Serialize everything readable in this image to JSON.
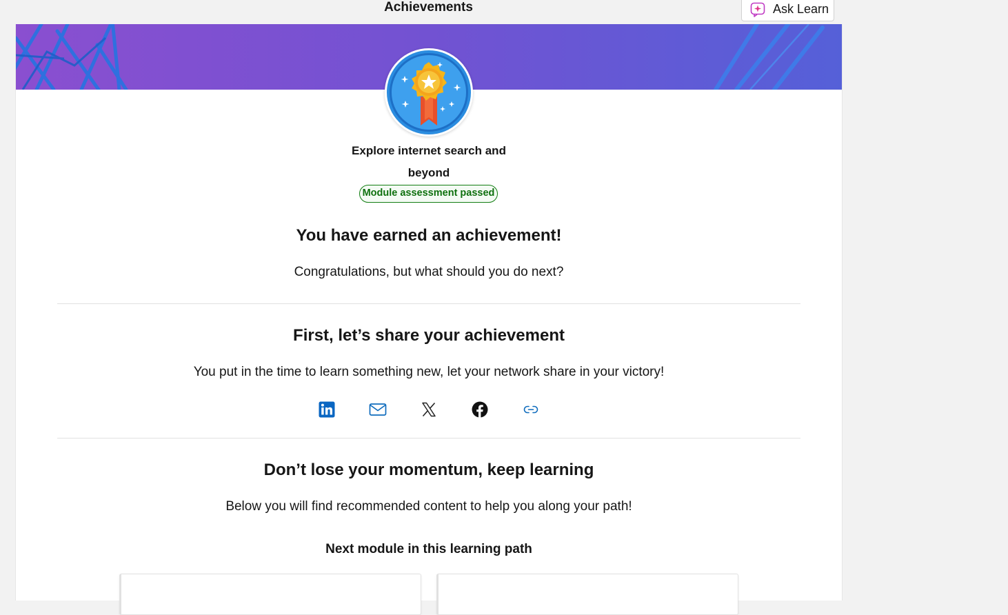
{
  "header": {
    "title": "Achievements",
    "ask_learn_label": "Ask Learn"
  },
  "achievement": {
    "module_title": "Explore internet search and beyond",
    "status": "Module assessment passed",
    "badge_icon": "medal-icon"
  },
  "earned": {
    "heading": "You have earned an achievement!",
    "subtext": "Congratulations, but what should you do next?"
  },
  "share": {
    "heading": "First, let’s share your achievement",
    "subtext": "You put in the time to learn something new, let your network share in your victory!",
    "buttons": [
      "linkedin-icon",
      "email-icon",
      "x-icon",
      "facebook-icon",
      "link-icon"
    ]
  },
  "keep_learning": {
    "heading": "Don’t lose your momentum, keep learning",
    "subtext": "Below you will find recommended content to help you along your path!",
    "next_module_heading": "Next module in this learning path"
  },
  "colors": {
    "banner_start": "#8a4fd0",
    "banner_end": "#5560d8",
    "passed_green": "#107c10",
    "linkedin_blue": "#0a66c2",
    "link_blue": "#0f6cbd"
  }
}
